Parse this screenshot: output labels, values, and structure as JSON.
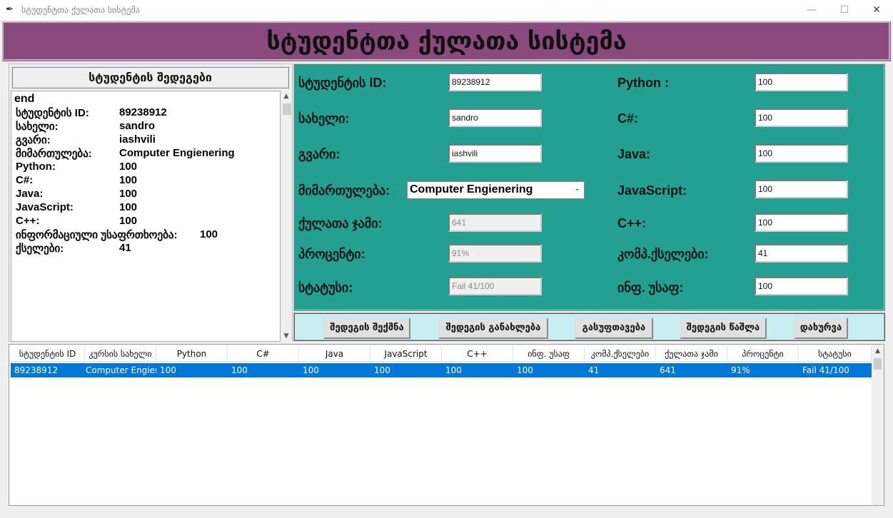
{
  "window": {
    "title": "სტუდენტთა ქულათა სისტემა",
    "min_glyph": "—",
    "max_glyph": "☐",
    "close_glyph": "✕",
    "app_icon": "feather-icon"
  },
  "banner": {
    "title": "სტუდენტთა ქულათა სისტემა"
  },
  "receipt": {
    "header": "სტუდენტის შედეგები",
    "first_line": "end",
    "lines": [
      {
        "key": "სტუდენტის ID:",
        "value": "89238912"
      },
      {
        "key": "სახელი:",
        "value": "sandro"
      },
      {
        "key": "გვარი:",
        "value": "iashvili"
      },
      {
        "key": "მიმართულება:",
        "value": "Computer Engienering"
      },
      {
        "key": "Python:",
        "value": "100"
      },
      {
        "key": "C#:",
        "value": "100"
      },
      {
        "key": "Java:",
        "value": "100"
      },
      {
        "key": "JavaScript:",
        "value": "100"
      },
      {
        "key": "C++:",
        "value": "100"
      },
      {
        "key": "ინფორმაციული უსაფრთხოება:",
        "value": "100"
      },
      {
        "key": "ქსელები:",
        "value": "41"
      }
    ]
  },
  "form": {
    "left": [
      {
        "label": "სტუდენტის ID:",
        "value": "89238912"
      },
      {
        "label": "სახელი:",
        "value": "sandro"
      },
      {
        "label": "გვარი:",
        "value": "iashvili"
      },
      {
        "label": "მიმართულება:",
        "value": "Computer Engienering"
      },
      {
        "label": "ქულათა ჯამი:",
        "value": "641"
      },
      {
        "label": "პროცენტი:",
        "value": "91%"
      },
      {
        "label": "სტატუსი:",
        "value": "Fail 41/100"
      }
    ],
    "right": [
      {
        "label": "Python :",
        "value": "100"
      },
      {
        "label": "C#:",
        "value": "100"
      },
      {
        "label": "Java:",
        "value": "100"
      },
      {
        "label": "JavaScript:",
        "value": "100"
      },
      {
        "label": "C++:",
        "value": "100"
      },
      {
        "label": "კომპ.ქსელები:",
        "value": "41"
      },
      {
        "label": "ინფ. უსაფ:",
        "value": "100"
      }
    ],
    "dropdown_chevron": "⌄"
  },
  "buttons": [
    "შედეგის შექმნა",
    "შედეგის განახლება",
    "გასუფთავება",
    "შედეგის წაშლა",
    "დახურვა"
  ],
  "table": {
    "columns": [
      "სტუდენტის ID",
      "კურსის სახელი",
      "Python",
      "C#",
      "Java",
      "JavaScript",
      "C++",
      "ინფ. უსაფ",
      "კომპ.ქსელები",
      "ქულათა ჯამი",
      "პროცენტი",
      "სტატუსი"
    ],
    "rows": [
      [
        "89238912",
        "Computer Engienering",
        "100",
        "100",
        "100",
        "100",
        "100",
        "100",
        "41",
        "641",
        "91%",
        "Fail 41/100"
      ]
    ],
    "selected_row_color": "#0078d7"
  },
  "colors": {
    "banner": "#8b4a7d",
    "form_bg": "#22a091",
    "button_bar": "#c8efef"
  }
}
